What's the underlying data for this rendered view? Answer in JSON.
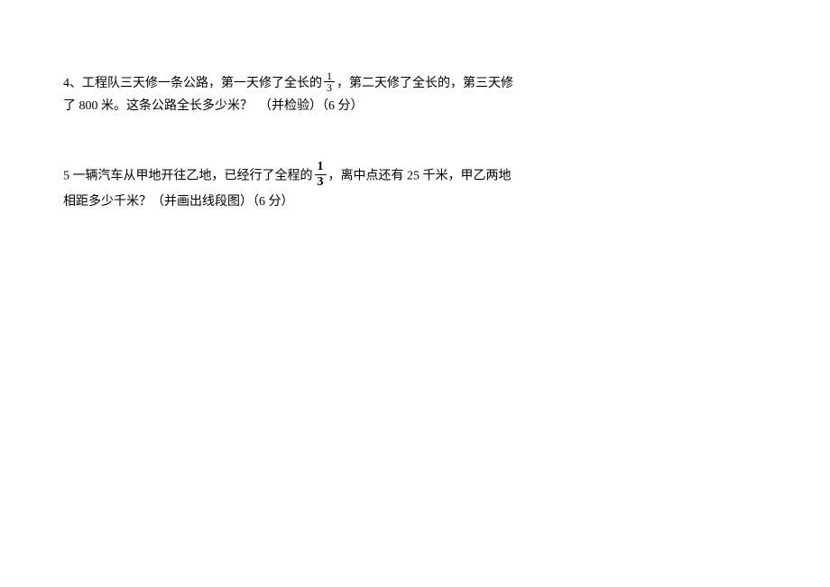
{
  "problems": [
    {
      "number": "4、",
      "line1_a": "工程队三天修一条公路，第一天修了全长的",
      "frac1_num": "1",
      "frac1_den": "3",
      "line1_b": "，第二天修了全长的，第三天修",
      "line2": "了 800 米。这条公路全长多少米？　（并检验）（6 分）"
    },
    {
      "number": "5 ",
      "line1_a": "一辆汽车从甲地开往乙地，已经行了全程的",
      "frac1_num": "1",
      "frac1_den": "3",
      "line1_b": "，离中点还有 25 千米，甲乙两地",
      "line2": "相距多少千米？（并画出线段图）（6 分）"
    }
  ]
}
